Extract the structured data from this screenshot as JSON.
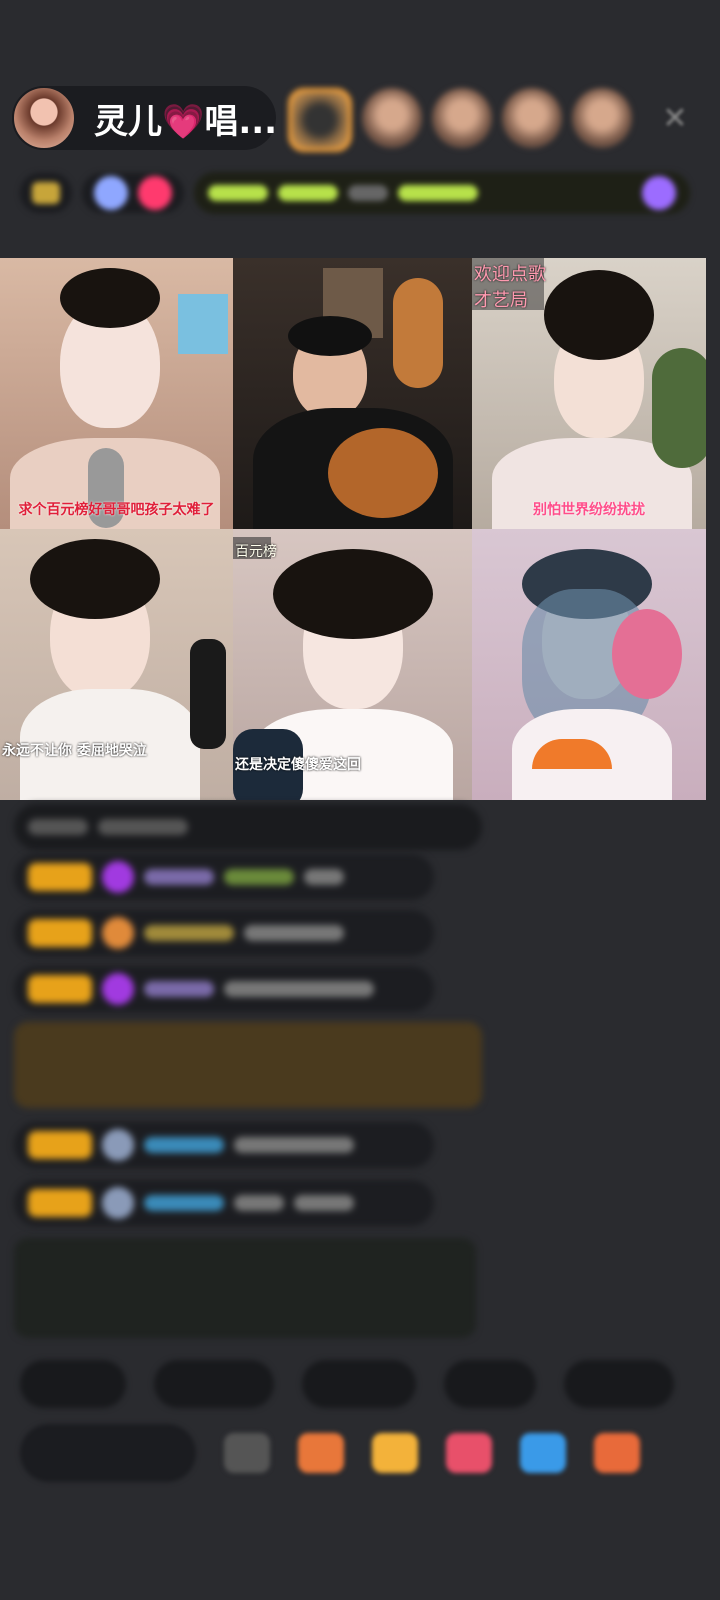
{
  "header": {
    "host_name": "灵儿💗唱...",
    "close": "✕"
  },
  "grid": {
    "cells": [
      {
        "top": "",
        "bottom": "求个百元榜好哥哥吧孩子太难了"
      },
      {
        "top": "",
        "bottom": ""
      },
      {
        "top": "欢迎点歌\n才艺局",
        "bottom": "别怕世界纷纷扰扰"
      },
      {
        "top": "",
        "bottom": "永远不让你 委屈地哭泣"
      },
      {
        "top": "百元榜",
        "bottom": "还是决定傻傻爱这回"
      },
      {
        "top": "",
        "bottom": ""
      }
    ]
  },
  "colors": {
    "background": "#2a2b2f",
    "badge": "#e7a21a",
    "accent_pink": "#ff4d8a"
  }
}
